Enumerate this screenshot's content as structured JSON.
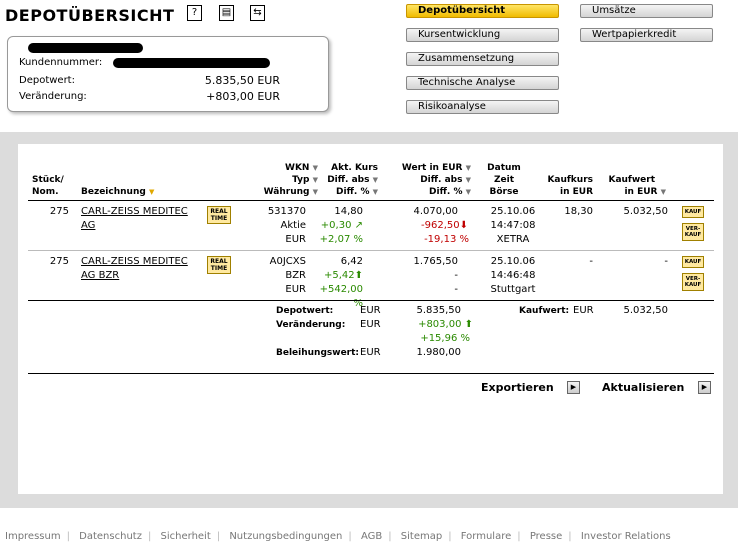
{
  "header": {
    "title": "DEPOTÜBERSICHT",
    "icons": [
      "help-icon",
      "print-icon",
      "refresh-icon"
    ]
  },
  "account": {
    "customer_label": "Kundennummer:",
    "depotwert_label": "Depotwert:",
    "depotwert_value": "5.835,50 EUR",
    "veraenderung_label": "Veränderung:",
    "veraenderung_value": "+803,00 EUR"
  },
  "nav": {
    "depotuebersicht": "Depotübersicht",
    "kursentwicklung": "Kursentwicklung",
    "zusammensetzung": "Zusammensetzung",
    "technische_analyse": "Technische Analyse",
    "risikoanalyse": "Risikoanalyse",
    "umsaetze": "Umsätze",
    "wertpapierkredit": "Wertpapierkredit"
  },
  "table": {
    "headers": {
      "stueck": "Stück/",
      "nom": "Nom.",
      "bezeichnung": "Bezeichnung",
      "wkn": "WKN",
      "typ": "Typ",
      "waehrung": "Währung",
      "akt_kurs": "Akt. Kurs",
      "diff_abs": "Diff. abs",
      "diff_pct": "Diff. %",
      "wert_in_eur": "Wert in EUR",
      "wert_diff_abs": "Diff. abs",
      "wert_diff_pct": "Diff. %",
      "datum": "Datum",
      "zeit": "Zeit",
      "boerse": "Börse",
      "kaufkurs": "Kaufkurs",
      "kaufkurs_unit": "in EUR",
      "kaufwert": "Kaufwert",
      "kaufwert_unit": "in EUR"
    },
    "realtime_badge": "REAL TIME",
    "kauf_label": "KAUF",
    "verkauf_label": "VER-KAUF",
    "rows": [
      {
        "qty": "275",
        "name_line1": "CARL-ZEISS MEDITEC",
        "name_line2": "AG",
        "wkn": "531370",
        "typ": "Aktie",
        "waehrung": "EUR",
        "kurs": "14,80",
        "diff_abs": "+0,30",
        "diff_pct": "+2,07 %",
        "wert": "4.070,00",
        "wert_diff_abs": "-962,50",
        "wert_diff_pct": "-19,13 %",
        "datum": "25.10.06",
        "zeit": "14:47:08",
        "boerse": "XETRA",
        "kaufkurs": "18,30",
        "kaufwert": "5.032,50"
      },
      {
        "qty": "275",
        "name_line1": "CARL-ZEISS MEDITEC",
        "name_line2": "AG BZR",
        "wkn": "A0JCXS",
        "typ": "BZR",
        "waehrung": "EUR",
        "kurs": "6,42",
        "diff_abs": "+5,42",
        "diff_pct": "+542,00 %",
        "wert": "1.765,50",
        "wert_diff_abs": "-",
        "wert_diff_pct": "-",
        "datum": "25.10.06",
        "zeit": "14:46:48",
        "boerse": "Stuttgart",
        "kaufkurs": "-",
        "kaufwert": "-"
      }
    ]
  },
  "summary": {
    "depotwert_label": "Depotwert:",
    "depotwert_cur": "EUR",
    "depotwert_value": "5.835,50",
    "veraenderung_label": "Veränderung:",
    "veraenderung_cur": "EUR",
    "veraenderung_value": "+803,00",
    "veraenderung_pct": "+15,96  %",
    "beleihungswert_label": "Beleihungswert:",
    "beleihungswert_cur": "EUR",
    "beleihungswert_value": "1.980,00",
    "kaufwert_label": "Kaufwert:",
    "kaufwert_cur": "EUR",
    "kaufwert_value": "5.032,50"
  },
  "actions": {
    "exportieren": "Exportieren",
    "aktualisieren": "Aktualisieren"
  },
  "footer": [
    "Impressum",
    "Datenschutz",
    "Sicherheit",
    "Nutzungsbedingungen",
    "AGB",
    "Sitemap",
    "Formulare",
    "Presse",
    "Investor Relations"
  ],
  "colors": {
    "positive": "#2a8a00",
    "negative": "#c00000",
    "active_tab": "#f0bb00",
    "panel_background": "#dcdcdc"
  }
}
